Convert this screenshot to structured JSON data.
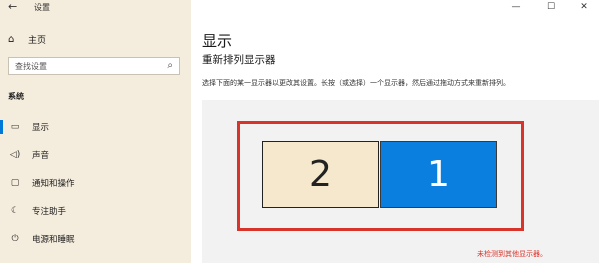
{
  "window": {
    "title": "设置",
    "back_icon": "back-arrow-icon",
    "controls": {
      "minimize": "—",
      "maximize": "☐",
      "close": "✕"
    }
  },
  "sidebar": {
    "home_label": "主页",
    "search_placeholder": "查找设置",
    "section_label": "系统",
    "items": [
      {
        "label": "显示",
        "icon": "monitor-icon",
        "active": true
      },
      {
        "label": "声音",
        "icon": "speaker-icon",
        "active": false
      },
      {
        "label": "通知和操作",
        "icon": "notification-icon",
        "active": false
      },
      {
        "label": "专注助手",
        "icon": "moon-icon",
        "active": false
      },
      {
        "label": "电源和睡眠",
        "icon": "power-icon",
        "active": false
      }
    ]
  },
  "main": {
    "title": "显示",
    "subtitle": "重新排列显示器",
    "description": "选择下面的某一显示器以更改其设置。长按（或选择）一个显示器，然后通过拖动方式来重新排列。",
    "monitors": [
      {
        "id": "2",
        "label": "2",
        "color": "#f5e8cc"
      },
      {
        "id": "1",
        "label": "1",
        "color": "#0a7fe0"
      }
    ],
    "warning": "未检测到其他显示器。",
    "highlight_color": "#d9342b",
    "accent_color": "#0078d7"
  }
}
